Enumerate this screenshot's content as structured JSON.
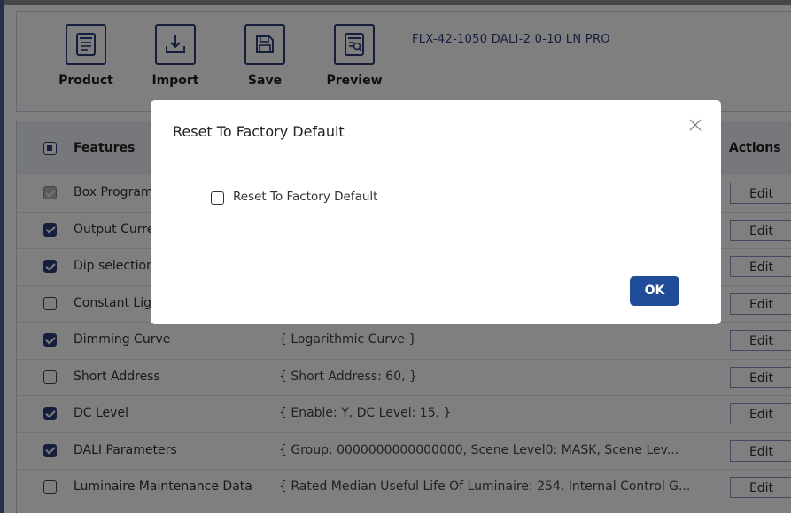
{
  "toolbar": {
    "buttons": [
      {
        "label": "Product",
        "icon": "product-icon"
      },
      {
        "label": "Import",
        "icon": "import-icon"
      },
      {
        "label": "Save",
        "icon": "save-icon"
      },
      {
        "label": "Preview",
        "icon": "preview-icon"
      }
    ],
    "product_name": "FLX-42-1050 DALI-2 0-10 LN PRO"
  },
  "table": {
    "headers": {
      "features": "Features",
      "actions": "Actions"
    },
    "header_checkbox": "indeterminate",
    "rows": [
      {
        "feature": "Box Program",
        "value": "",
        "state": "disabled",
        "action": "Edit"
      },
      {
        "feature": "Output Current",
        "value": "",
        "state": "checked",
        "action": "Edit"
      },
      {
        "feature": "Dip selection",
        "value": "",
        "state": "checked",
        "action": "Edit"
      },
      {
        "feature": "Constant Light",
        "value": "",
        "state": "unchecked",
        "action": "Edit"
      },
      {
        "feature": "Dimming Curve",
        "value": "{ Logarithmic Curve }",
        "state": "checked",
        "action": "Edit"
      },
      {
        "feature": "Short Address",
        "value": "{ Short Address: 60, }",
        "state": "unchecked",
        "action": "Edit"
      },
      {
        "feature": "DC Level",
        "value": "{ Enable: Y, DC Level: 15, }",
        "state": "checked",
        "action": "Edit"
      },
      {
        "feature": "DALI Parameters",
        "value": "{ Group: 0000000000000000, Scene Level0: MASK, Scene Lev...",
        "state": "checked",
        "action": "Edit"
      },
      {
        "feature": "Luminaire Maintenance Data",
        "value": "{ Rated Median Useful Life Of Luminaire: 254, Internal Control G...",
        "state": "unchecked",
        "action": "Edit"
      }
    ]
  },
  "modal": {
    "title": "Reset To Factory Default",
    "checkbox_label": "Reset To Factory Default",
    "checkbox_checked": false,
    "ok_label": "OK",
    "close_icon": "close-icon"
  },
  "colors": {
    "accent": "#2a3f7a",
    "ok_button": "#1f4d9a",
    "header_bg": "#eef0f8"
  }
}
